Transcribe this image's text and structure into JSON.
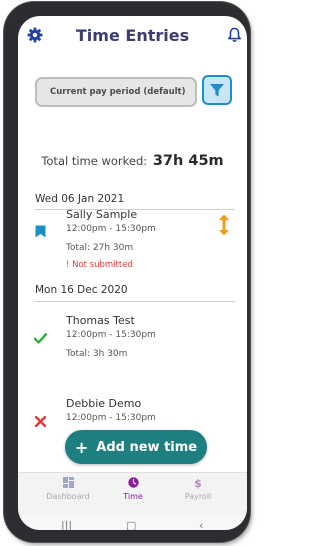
{
  "header": {
    "title": "Time Entries"
  },
  "filter": {
    "period_label": "Current pay period (default)"
  },
  "summary": {
    "label": "Total time worked:",
    "value": "37h 45m"
  },
  "sections": [
    {
      "date": "Wed 06 Jan 2021",
      "entries": [
        {
          "name": "Sally Sample",
          "time": "12:00pm - 15:30pm",
          "total": "Total: 27h 30m",
          "warning": "! Not submitted"
        }
      ]
    },
    {
      "date": "Mon 16 Dec 2020",
      "entries": [
        {
          "name": "Thomas Test",
          "time": "12:00pm - 15:30pm",
          "total": "Total: 3h 30m"
        },
        {
          "name": "Debbie Demo",
          "time": "12:00pm - 15:30pm"
        }
      ]
    }
  ],
  "add_button": {
    "label": "Add new time"
  },
  "bottom_nav": {
    "items": [
      {
        "label": "Dashboard",
        "icon": "dashboard-icon"
      },
      {
        "label": "Time",
        "icon": "clock-icon",
        "active": true
      },
      {
        "label": "Payroll",
        "icon": "dollar-icon"
      }
    ]
  },
  "colors": {
    "brand_title": "#3a3d6e",
    "accent_blue": "#1c8fc9",
    "button_teal": "#1e7f80",
    "active_nav": "#8a1d9c",
    "warning_red": "#e53935",
    "success_green": "#2fae3b",
    "pending_orange": "#f39c12"
  }
}
